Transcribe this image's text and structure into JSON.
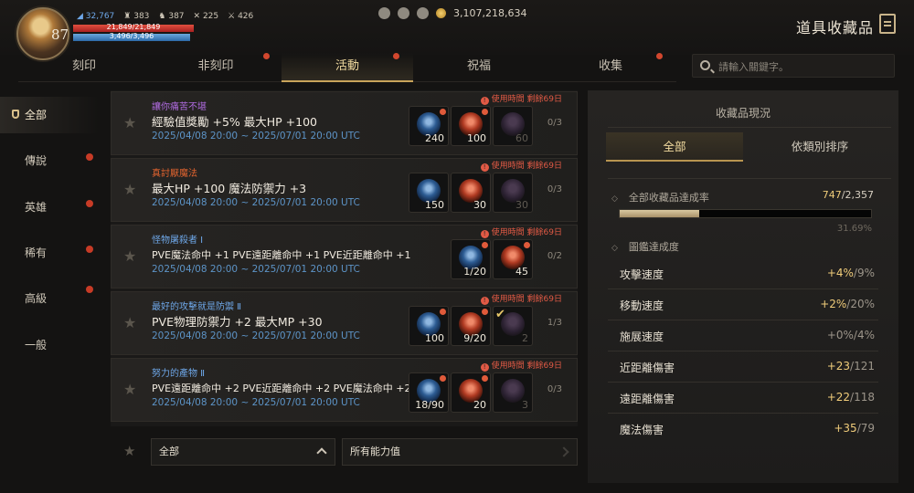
{
  "player": {
    "level": "87",
    "stat_1": "32,767",
    "stat_2": "383",
    "stat_3": "387",
    "stat_4": "225",
    "stat_5": "426",
    "hp_text": "21,849/21,849",
    "mp_text": "3,496/3,496",
    "hp_fraction": 1.0,
    "mp_fraction": 1.0
  },
  "currency": {
    "gold": "3,107,218,634"
  },
  "header": {
    "title": "道具收藏品"
  },
  "tabs": [
    {
      "label": "刻印"
    },
    {
      "label": "非刻印"
    },
    {
      "label": "活動"
    },
    {
      "label": "祝福"
    },
    {
      "label": "收集"
    }
  ],
  "search": {
    "placeholder": "請輸入關鍵字。"
  },
  "sidebar": {
    "items": [
      {
        "label": "全部"
      },
      {
        "label": "傳說"
      },
      {
        "label": "英雄"
      },
      {
        "label": "稀有"
      },
      {
        "label": "高級"
      },
      {
        "label": "一般"
      }
    ]
  },
  "quests": [
    {
      "category": "讓你痛苦不堪",
      "title": "經驗值獎勵 +5% 最大HP +100",
      "date": "2025/04/08 20:00 ~ 2025/07/01 20:00 UTC",
      "timer": "使用時間 剩餘69日",
      "count": "0/3",
      "rewards": [
        "240",
        "100",
        "60"
      ]
    },
    {
      "category": "真討厭魔法",
      "title": "最大HP +100 魔法防禦力 +3",
      "date": "2025/04/08 20:00 ~ 2025/07/01 20:00 UTC",
      "timer": "使用時間 剩餘69日",
      "count": "0/3",
      "rewards": [
        "150",
        "30",
        "30"
      ]
    },
    {
      "category": "怪物屠殺者 Ⅰ",
      "title": "PVE魔法命中 +1 PVE遠距離命中 +1 PVE近距離命中 +1",
      "date": "2025/04/08 20:00 ~ 2025/07/01 20:00 UTC",
      "timer": "使用時間 剩餘69日",
      "count": "0/2",
      "rewards": [
        "1/20",
        "45"
      ]
    },
    {
      "category": "最好的攻擊就是防禦 Ⅱ",
      "title": "PVE物理防禦力 +2 最大MP +30",
      "date": "2025/04/08 20:00 ~ 2025/07/01 20:00 UTC",
      "timer": "使用時間 剩餘69日",
      "count": "1/3",
      "rewards": [
        "100",
        "9/20",
        "2"
      ]
    },
    {
      "category": "努力的產物 Ⅱ",
      "title": "PVE遠距離命中 +2 PVE近距離命中 +2 PVE魔法命中 +2",
      "date": "2025/04/08 20:00 ~ 2025/07/01 20:00 UTC",
      "timer": "使用時間 剩餘69日",
      "count": "0/3",
      "rewards": [
        "18/90",
        "20",
        "3"
      ]
    }
  ],
  "filters": {
    "grade": "全部",
    "ability": "所有能力值"
  },
  "collection": {
    "title": "收藏品現況",
    "seg_all": "全部",
    "seg_sort": "依類別排序",
    "rate_label": "全部收藏品達成率",
    "rate_done": "747",
    "rate_total": "/2,357",
    "rate_fraction": 0.3169,
    "rate_pct": "31.69%",
    "codex_label": "圖鑑達成度",
    "stats": [
      {
        "name": "攻擊速度",
        "gain": "+4%",
        "max": "/9%"
      },
      {
        "name": "移動速度",
        "gain": "+2%",
        "max": "/20%"
      },
      {
        "name": "施展速度",
        "gain": "+0%",
        "max": "/4%"
      },
      {
        "name": "近距離傷害",
        "gain": "+23",
        "max": "/121"
      },
      {
        "name": "遠距離傷害",
        "gain": "+22",
        "max": "/118"
      },
      {
        "name": "魔法傷害",
        "gain": "+35",
        "max": "/79"
      }
    ]
  }
}
